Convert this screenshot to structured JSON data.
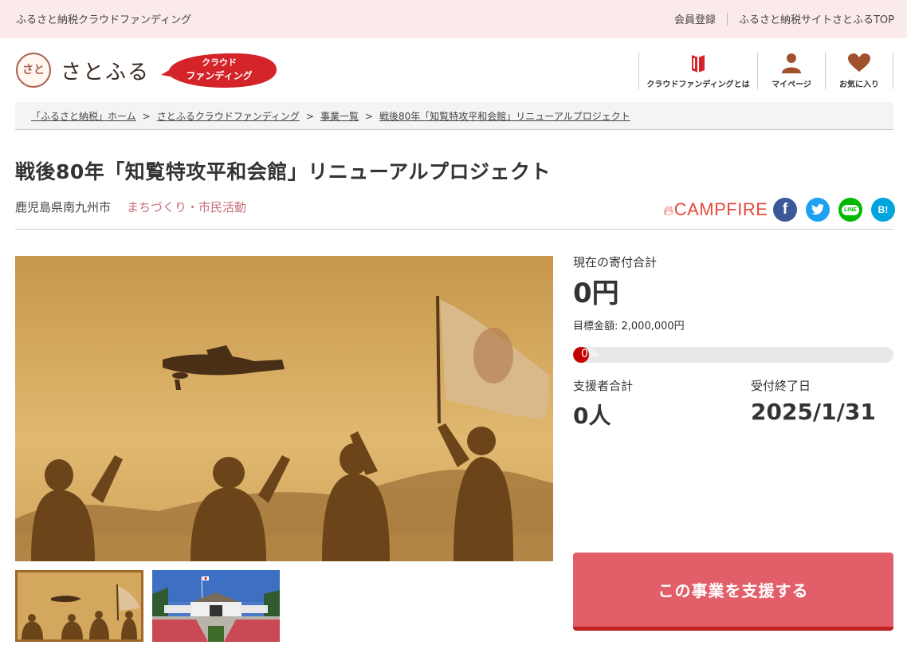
{
  "topbar": {
    "site_name": "ふるさと納税クラウドファンディング",
    "register": "会員登録",
    "top_link": "ふるさと納税サイトさとふるTOP"
  },
  "header": {
    "logo_text": "さとふる",
    "logo_mark": "さと",
    "badge_line1": "クラウド",
    "badge_line2": "ファンディング",
    "nav": [
      {
        "label": "クラウドファンディングとは",
        "icon": "book-icon"
      },
      {
        "label": "マイページ",
        "icon": "user-icon"
      },
      {
        "label": "お気に入り",
        "icon": "heart-icon"
      }
    ]
  },
  "breadcrumb": [
    "「ふるさと納税」ホーム",
    "さとふるクラウドファンディング",
    "事業一覧",
    "戦後80年「知覧特攻平和会館」リニューアルプロジェクト"
  ],
  "breadcrumb_sep": ">",
  "project": {
    "title": "戦後80年「知覧特攻平和会館」リニューアルプロジェクト",
    "location": "鹿児島県南九州市",
    "category": "まちづくり・市民活動"
  },
  "partner": "CAMPFIRE",
  "share": {
    "fb": "f",
    "tw": "t",
    "line": "LINE",
    "hatena": "B!"
  },
  "stats": {
    "current_label": "現在の寄付合計",
    "current_value": "0円",
    "goal_text": "目標金額: 2,000,000円",
    "progress_text": "0%",
    "progress_fraction": 0.0,
    "supporters_label": "支援者合計",
    "supporters_value": "0人",
    "deadline_label": "受付終了日",
    "deadline_value": "2025/1/31"
  },
  "cta": {
    "label": "この事業を支援する"
  },
  "colors": {
    "topbar_bg": "#fbeaea",
    "accent_red": "#e25f6a",
    "category": "#c8707a",
    "campfire": "#e64a3c",
    "progress": "#c40000"
  }
}
